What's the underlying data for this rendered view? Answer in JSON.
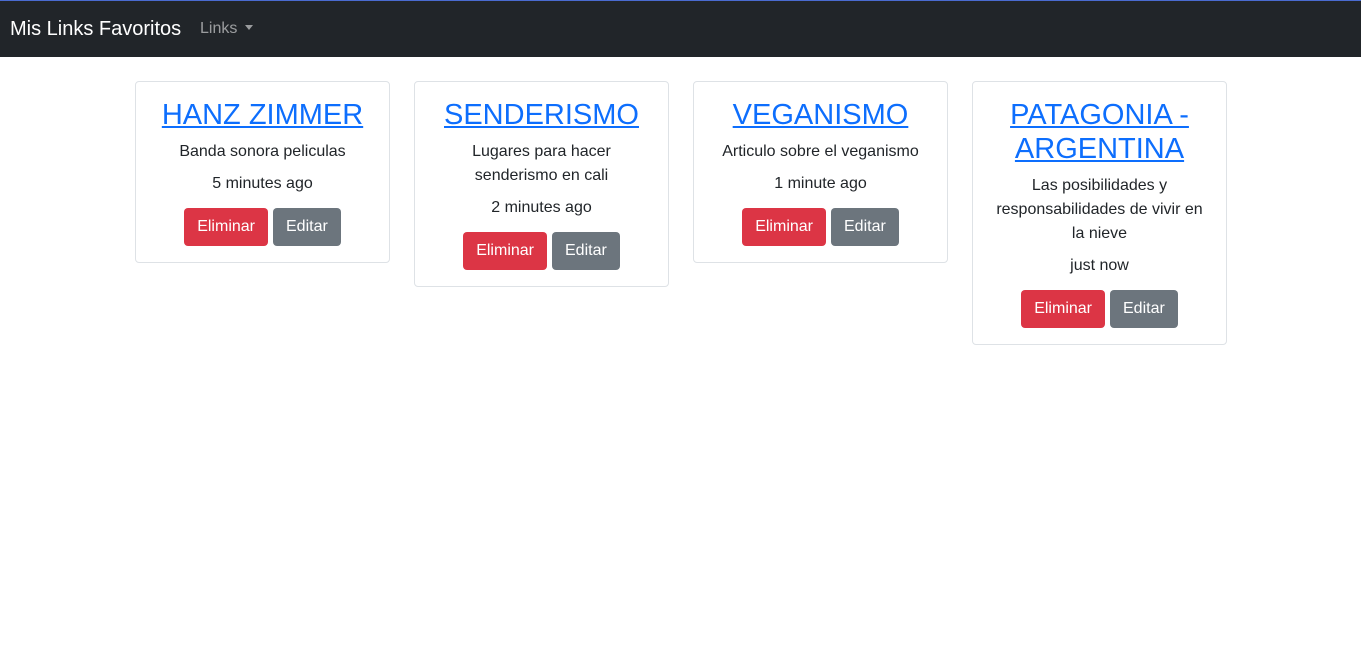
{
  "navbar": {
    "brand": "Mis Links Favoritos",
    "dropdown_label": "Links"
  },
  "links": [
    {
      "title": "HANZ ZIMMER",
      "description": "Banda sonora peliculas",
      "time": "5 minutes ago",
      "delete_label": "Eliminar",
      "edit_label": "Editar"
    },
    {
      "title": "SENDERISMO",
      "description": "Lugares para hacer senderismo en cali",
      "time": "2 minutes ago",
      "delete_label": "Eliminar",
      "edit_label": "Editar"
    },
    {
      "title": "VEGANISMO",
      "description": "Articulo sobre el veganismo",
      "time": "1 minute ago",
      "delete_label": "Eliminar",
      "edit_label": "Editar"
    },
    {
      "title": "PATAGONIA - ARGENTINA",
      "description": "Las posibilidades y responsabilidades de vivir en la nieve",
      "time": "just now",
      "delete_label": "Eliminar",
      "edit_label": "Editar"
    }
  ],
  "colors": {
    "navbar_bg": "#212529",
    "link": "#0d6efd",
    "danger": "#dc3545",
    "secondary": "#6c757d"
  }
}
